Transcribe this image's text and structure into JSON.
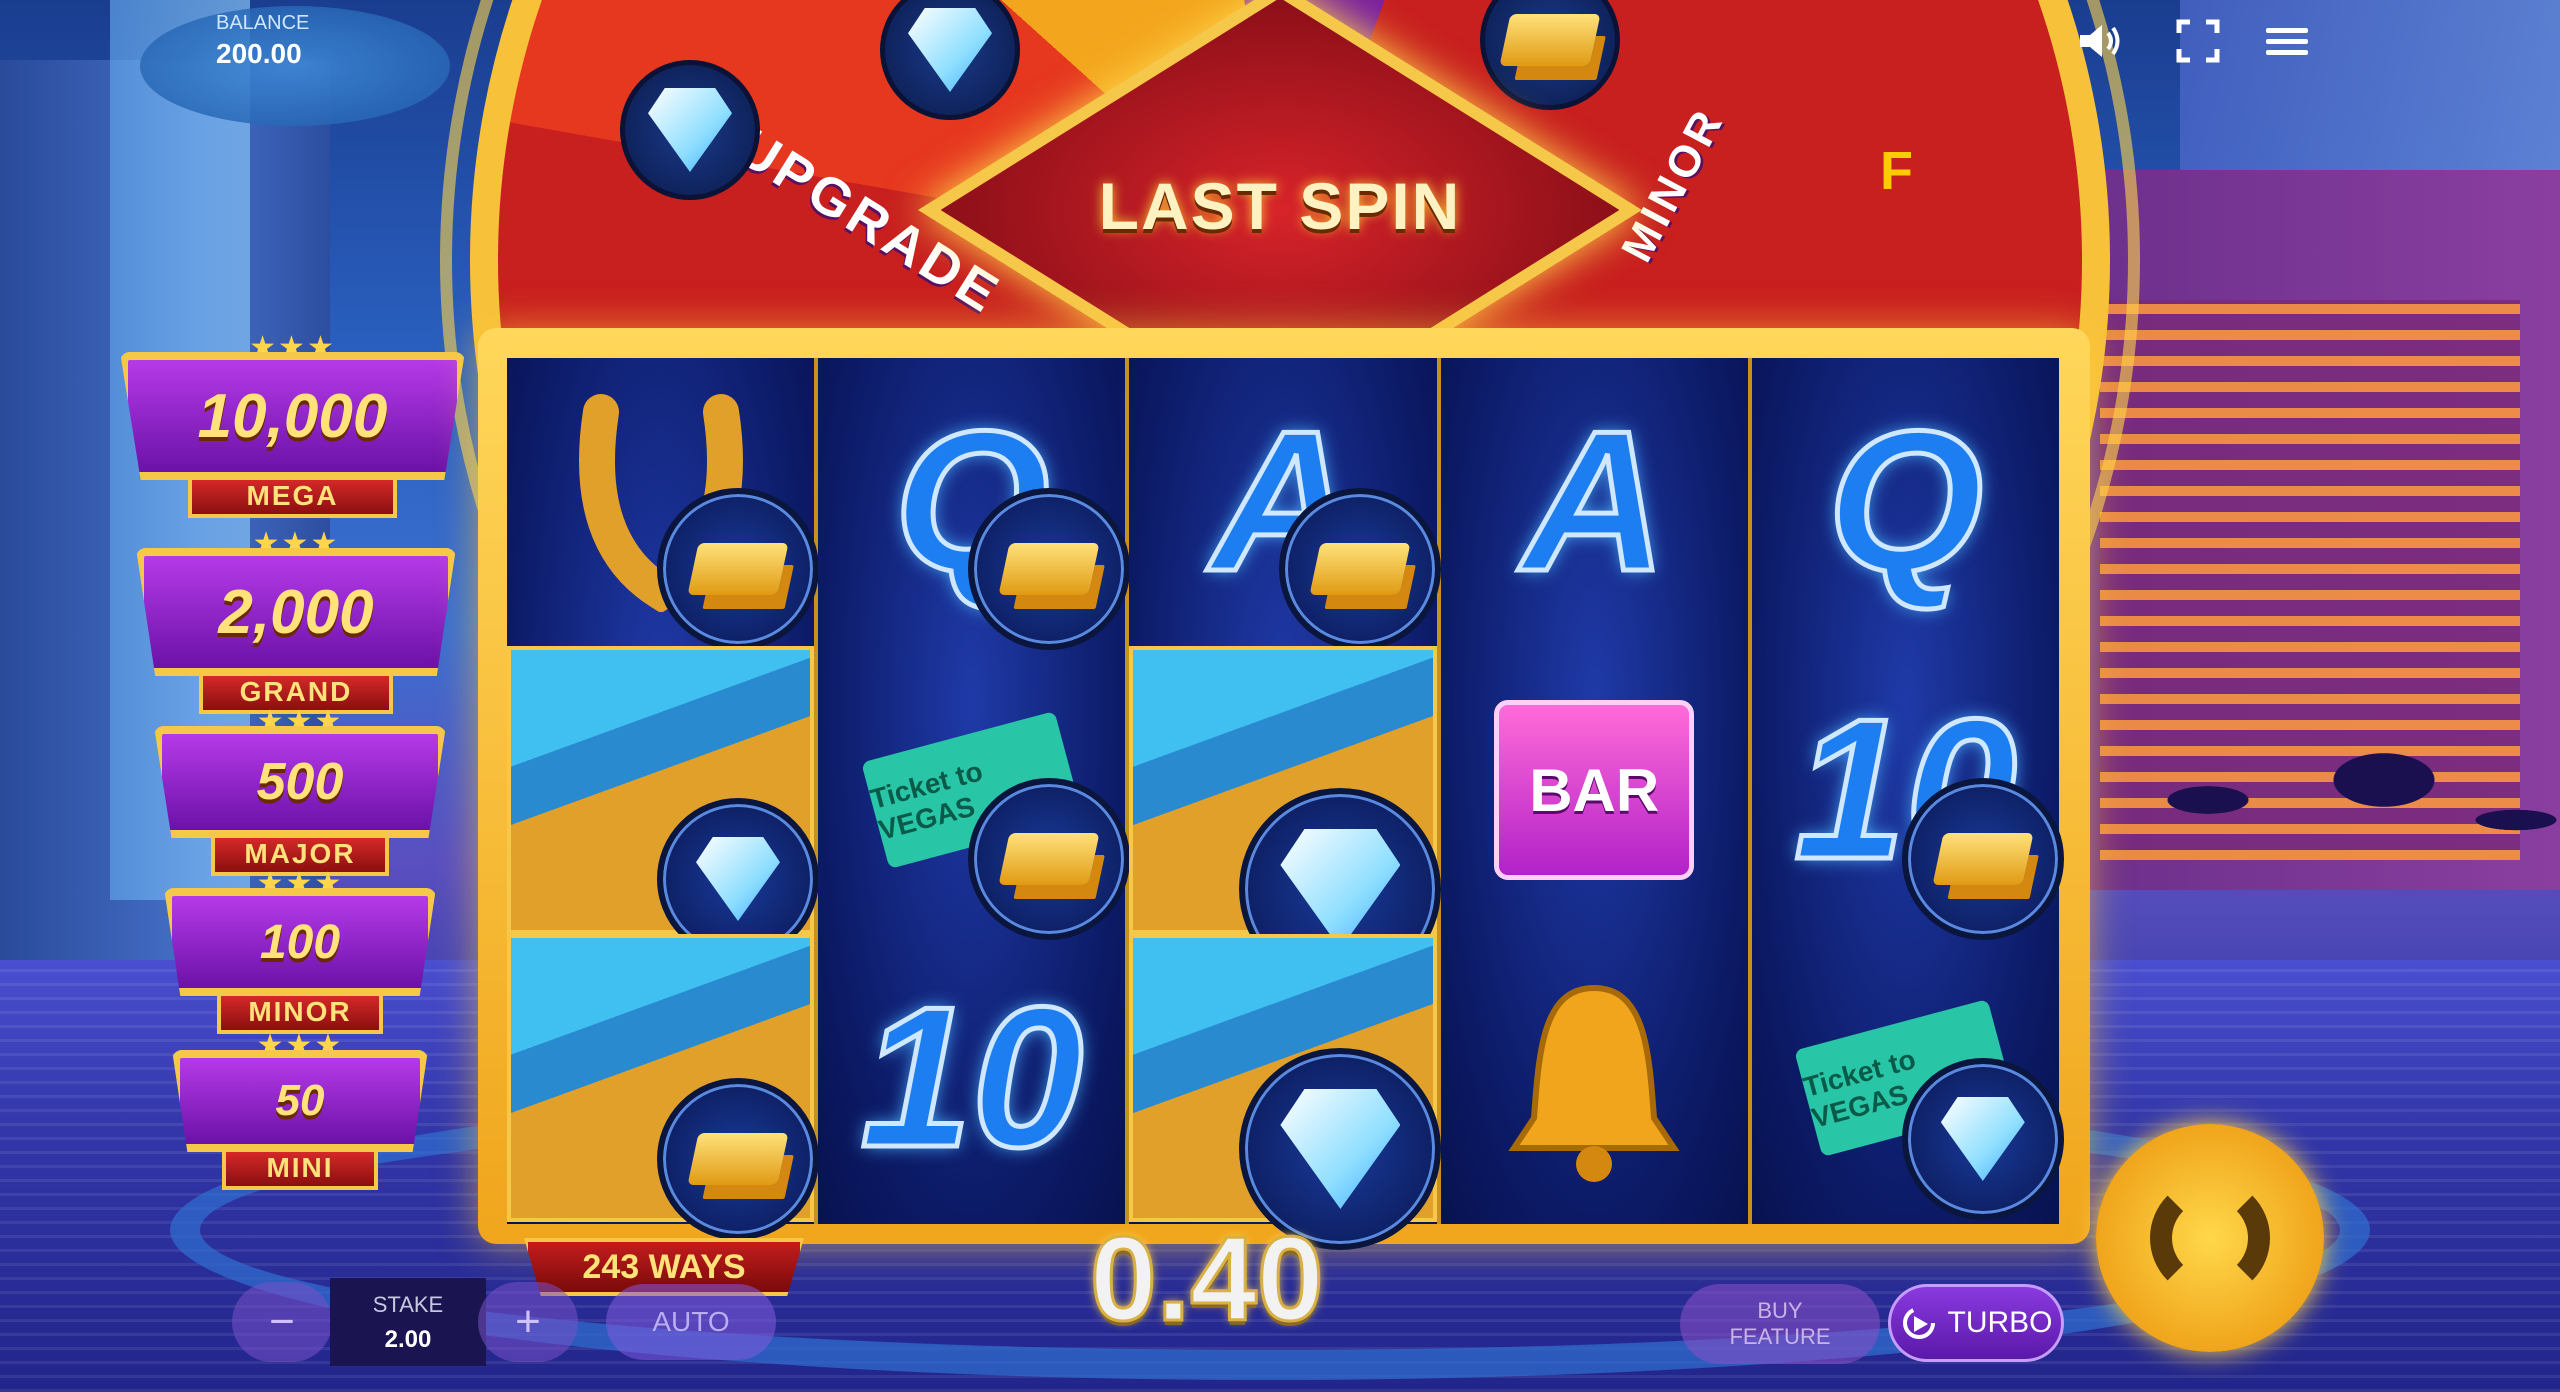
{
  "balance": {
    "label": "BALANCE",
    "value": "200.00"
  },
  "wheel": {
    "segments": [
      "UPGRADE",
      "MINOR",
      "F"
    ]
  },
  "banner": {
    "text": "LAST SPIN"
  },
  "jackpots": [
    {
      "value": "10,000",
      "label": "MEGA"
    },
    {
      "value": "2,000",
      "label": "GRAND"
    },
    {
      "value": "500",
      "label": "MAJOR"
    },
    {
      "value": "100",
      "label": "MINOR"
    },
    {
      "value": "50",
      "label": "MINI"
    }
  ],
  "reels": {
    "r2_top": "Q",
    "r3_top": "A",
    "r4_top": "A",
    "r5_top": "Q",
    "r2_bottom": "10",
    "r5_mid": "10",
    "bar_text": "BAR",
    "ticket_text": "Ticket to VEGAS"
  },
  "ways": "243 WAYS",
  "win": "0.40",
  "stake": {
    "label": "STAKE",
    "value": "2.00"
  },
  "buttons": {
    "minus": "−",
    "plus": "+",
    "auto": "AUTO",
    "buy_feature": "BUY FEATURE",
    "turbo": "TURBO"
  },
  "icons": [
    "sound-icon",
    "fullscreen-icon",
    "menu-icon",
    "spin-icon",
    "turbo-icon"
  ],
  "colors": {
    "frame": "#f6c84a",
    "reel_bg": "#0c1a66",
    "jackpot_panel": "#8a22c8",
    "turbo": "#7a2ad0"
  }
}
